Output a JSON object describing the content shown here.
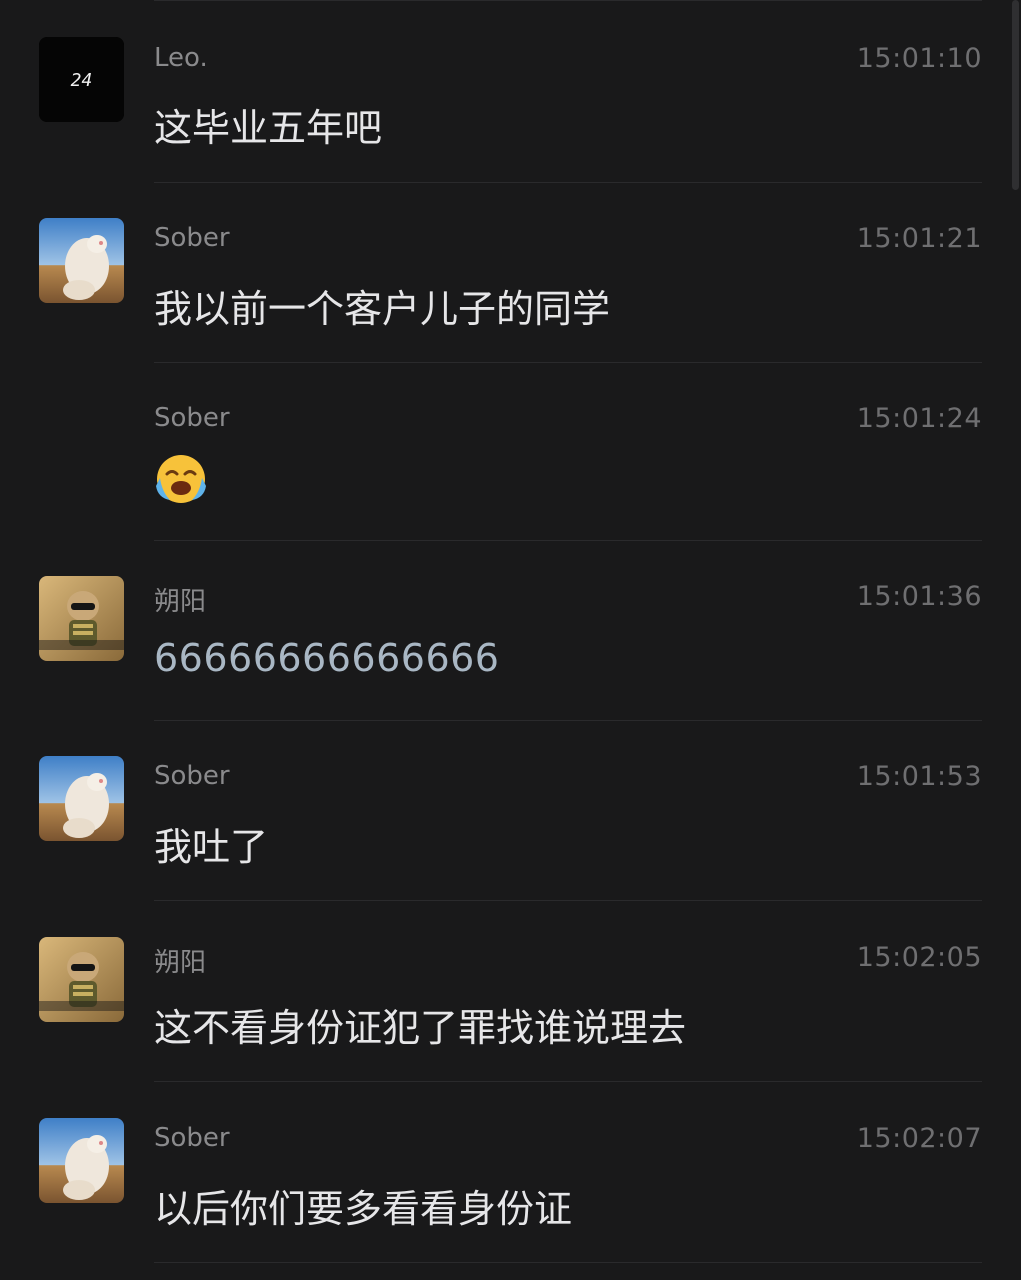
{
  "messages": [
    {
      "sender": "Leo.",
      "time": "15:01:10",
      "text": "这毕业五年吧",
      "avatar": "clock-24-avatar"
    },
    {
      "sender": "Sober",
      "time": "15:01:21",
      "text": "我以前一个客户儿子的同学",
      "avatar": "cat-avatar"
    },
    {
      "sender": "Sober",
      "time": "15:01:24",
      "text": "",
      "emoji": "loudly-crying-face-emoji"
    },
    {
      "sender": "朔阳",
      "time": "15:01:36",
      "text": "66666666666666",
      "avatar": "soldier-avatar"
    },
    {
      "sender": "Sober",
      "time": "15:01:53",
      "text": "我吐了",
      "avatar": "cat-avatar"
    },
    {
      "sender": "朔阳",
      "time": "15:02:05",
      "text": "这不看身份证犯了罪找谁说理去",
      "avatar": "soldier-avatar"
    },
    {
      "sender": "Sober",
      "time": "15:02:07",
      "text": "以后你们要多看看身份证",
      "avatar": "cat-avatar"
    }
  ],
  "avatar_badges": {
    "leo": "24"
  },
  "colors": {
    "background": "#19191a",
    "message_text": "#e6e6e8",
    "sender_text": "#8a8a8c",
    "time_text": "#6f6f71",
    "numeric_text": "#a9b7c4"
  }
}
